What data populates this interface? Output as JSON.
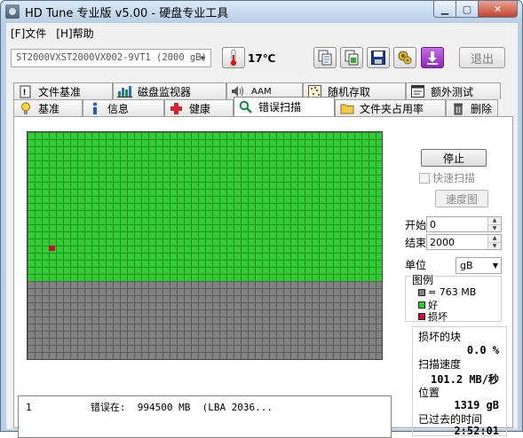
{
  "window": {
    "title": "HD Tune 专业版 v5.00 - 硬盘专业工具"
  },
  "menu": [
    "[F]文件",
    "[H]帮助"
  ],
  "toolbar": {
    "drive": "ST2000VXST2000VX002-9VT1  (2000 gB)",
    "temperature": "17℃",
    "exit_label": "退出",
    "buttons": [
      "copy-text-icon",
      "copy-screenshot-icon",
      "save-icon",
      "options-icon",
      "download-icon"
    ]
  },
  "tabs_row1": [
    {
      "label": "文件基准",
      "icon": "file-benchmark-icon"
    },
    {
      "label": "磁盘监视器",
      "icon": "disk-monitor-icon"
    },
    {
      "label": "AAM",
      "icon": "speaker-icon"
    },
    {
      "label": "随机存取",
      "icon": "random-access-icon"
    },
    {
      "label": "额外测试",
      "icon": "extra-tests-icon"
    }
  ],
  "tabs_row2": [
    {
      "label": "基准",
      "icon": "lightbulb-icon"
    },
    {
      "label": "信息",
      "icon": "info-icon"
    },
    {
      "label": "健康",
      "icon": "health-cross-icon"
    },
    {
      "label": "错误扫描",
      "icon": "magnifier-icon",
      "active": true
    },
    {
      "label": "文件夹占用率",
      "icon": "folder-icon"
    },
    {
      "label": "删除",
      "icon": "trash-icon"
    }
  ],
  "scan": {
    "stop_label": "停止",
    "quick_scan_label": "快速扫描",
    "speed_map_label": "速度图",
    "start_label": "开始",
    "start_value": "0",
    "end_label": "结束",
    "end_value": "2000",
    "unit_label": "单位",
    "unit_value": "gB",
    "legend_title": "图例",
    "legend_block": "= 763 MB",
    "legend_good": "好",
    "legend_bad": "损坏",
    "damaged_label": "损坏的块",
    "damaged_value": "0.0 %",
    "speed_label": "扫描速度",
    "speed_value": "101.2 MB/秒",
    "position_label": "位置",
    "position_value": "1319 gB",
    "elapsed_label": "已过去的时间",
    "elapsed_value": "2:52:01",
    "progress_fraction": 0.66,
    "colors": {
      "good": "#2fcd2f",
      "bad": "#c8102e",
      "pending": "#828282"
    }
  },
  "log": {
    "index": "1",
    "text": "错误在:  994500 MB  (LBA 2036..."
  }
}
